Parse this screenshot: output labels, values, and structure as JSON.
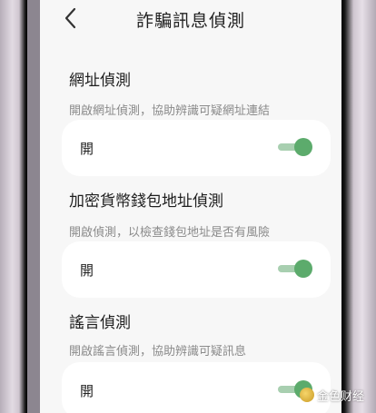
{
  "header": {
    "title": "詐騙訊息偵測",
    "back_icon": "chevron-left-icon"
  },
  "sections": [
    {
      "title": "網址偵測",
      "description": "開啟網址偵測，協助辨識可疑網址連結",
      "toggle_label": "開",
      "enabled": true
    },
    {
      "title": "加密貨幣錢包地址偵測",
      "description": "開啟偵測，以檢查錢包地址是否有風險",
      "toggle_label": "開",
      "enabled": true
    },
    {
      "title": "謠言偵測",
      "description": "開啟謠言偵測，協助辨識可疑訊息",
      "toggle_label": "開",
      "enabled": true
    }
  ],
  "watermark": {
    "text": "金色财经"
  },
  "colors": {
    "toggle_on": "#5cab6c",
    "toggle_track": "#a8cfb0",
    "screen_bg": "#f7f7f7",
    "card_bg": "#ffffff"
  }
}
